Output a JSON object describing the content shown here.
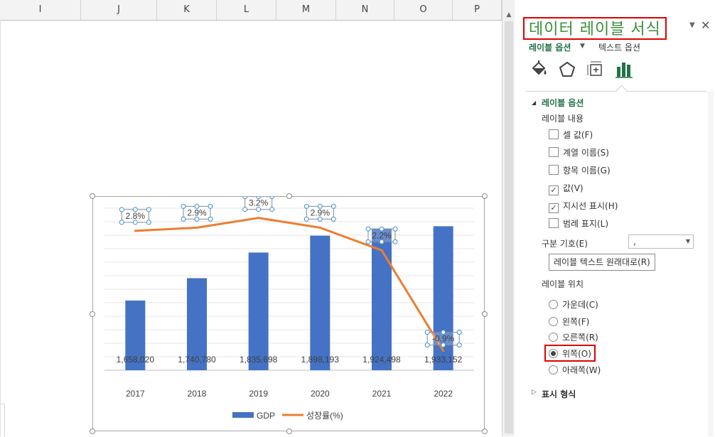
{
  "sheet": {
    "columns": [
      "I",
      "J",
      "K",
      "L",
      "M",
      "N",
      "O",
      "P"
    ]
  },
  "chart_data": {
    "type": "bar",
    "categories": [
      "2017",
      "2018",
      "2019",
      "2020",
      "2021",
      "2022"
    ],
    "series": [
      {
        "name": "GDP",
        "type": "bar",
        "color": "#4472c4",
        "values": [
          1658020,
          1740780,
          1835698,
          1898193,
          1924498,
          1933152
        ],
        "labels": [
          "1,658,020",
          "1,740,780",
          "1,835,698",
          "1,898,193",
          "1,924,498",
          "1,933,152"
        ]
      },
      {
        "name": "성장률(%)",
        "type": "line",
        "color": "#ed7d31",
        "values": [
          2.8,
          2.9,
          3.2,
          2.9,
          2.2,
          -0.9
        ],
        "labels": [
          "2.8%",
          "2.9%",
          "3.2%",
          "2.9%",
          "2.2%",
          "-0.9%"
        ]
      }
    ],
    "ylim_bar": [
      1400000,
      2000000
    ],
    "ylim_line": [
      -1.5,
      3.5
    ],
    "grid": true,
    "legend": "bottom"
  },
  "pane": {
    "title": "데이터 레이블 서식",
    "tab_label_options": "레이블 옵션",
    "tab_text_options": "텍스트 옵션",
    "section_label_options": "레이블 옵션",
    "label_contents_title": "레이블 내용",
    "checkboxes": [
      {
        "label": "셀 값(F)",
        "checked": false
      },
      {
        "label": "계열 이름(S)",
        "checked": false
      },
      {
        "label": "항목 이름(G)",
        "checked": false
      },
      {
        "label": "값(V)",
        "checked": true
      },
      {
        "label": "지시선 표시(H)",
        "checked": true
      },
      {
        "label": "범례 표지(L)",
        "checked": false
      }
    ],
    "separator_label": "구분 기호(E)",
    "separator_value": ",",
    "reset_button": "레이블 텍스트 원래대로(R)",
    "label_position_title": "레이블 위치",
    "radios": [
      {
        "label": "가운데(C)",
        "selected": false
      },
      {
        "label": "왼쪽(F)",
        "selected": false
      },
      {
        "label": "오른쪽(R)",
        "selected": false
      },
      {
        "label": "위쪽(O)",
        "selected": true
      },
      {
        "label": "아래쪽(W)",
        "selected": false
      }
    ],
    "section_number_format": "표시 형식"
  }
}
